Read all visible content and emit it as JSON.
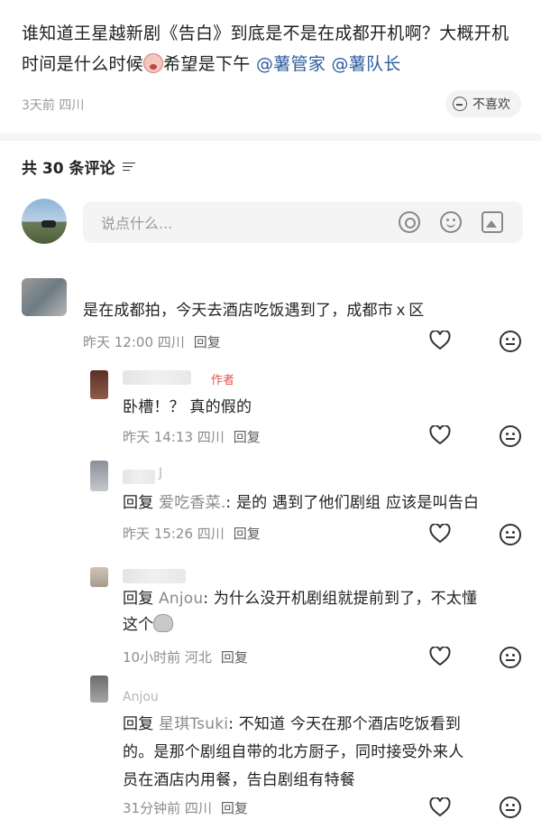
{
  "post": {
    "text_before": "谁知道王星越新剧《告白》到底是不是在成都开机啊？大概开机时间是什么时候",
    "text_after": "希望是下午 ",
    "mention_1": "@薯管家",
    "mention_2": "@薯队长",
    "meta": "3天前 四川",
    "dislike_label": "不喜欢"
  },
  "comments_header": {
    "count_label": "共 30 条评论"
  },
  "composer": {
    "placeholder": "说点什么..."
  },
  "comments": [
    {
      "text": "是在成都拍，今天去酒店吃饭遇到了，成都市ｘ区",
      "meta": "昨天 12:00 四川",
      "reply": "回复"
    },
    {
      "author_tag": "作者",
      "text": "卧槽！？ 真的假的",
      "meta": "昨天 14:13 四川",
      "reply": "回复"
    },
    {
      "name": "J",
      "reply_prefix": "回复 ",
      "reply_to": "爱吃香菜.",
      "text": ": 是的 遇到了他们剧组 应该是叫告白",
      "meta": "昨天 15:26 四川",
      "reply": "回复"
    },
    {
      "reply_prefix": "回复 ",
      "reply_to": "Anjou",
      "text_line1": ": 为什么没开机剧组就提前到了，不太懂",
      "text_line2": "这个",
      "meta": "10小时前 河北",
      "reply": "回复"
    },
    {
      "name": "Anjou",
      "reply_prefix": "回复 ",
      "reply_to": "星琪Tsuki",
      "text_line1": ": 不知道 今天在那个酒店吃饭看到",
      "text_line2": "的。是那个剧组自带的北方厨子，同时接受外来人",
      "text_line3": "员在酒店内用餐，告白剧组有特餐",
      "meta": "31分钟前 四川",
      "reply": "回复"
    }
  ]
}
